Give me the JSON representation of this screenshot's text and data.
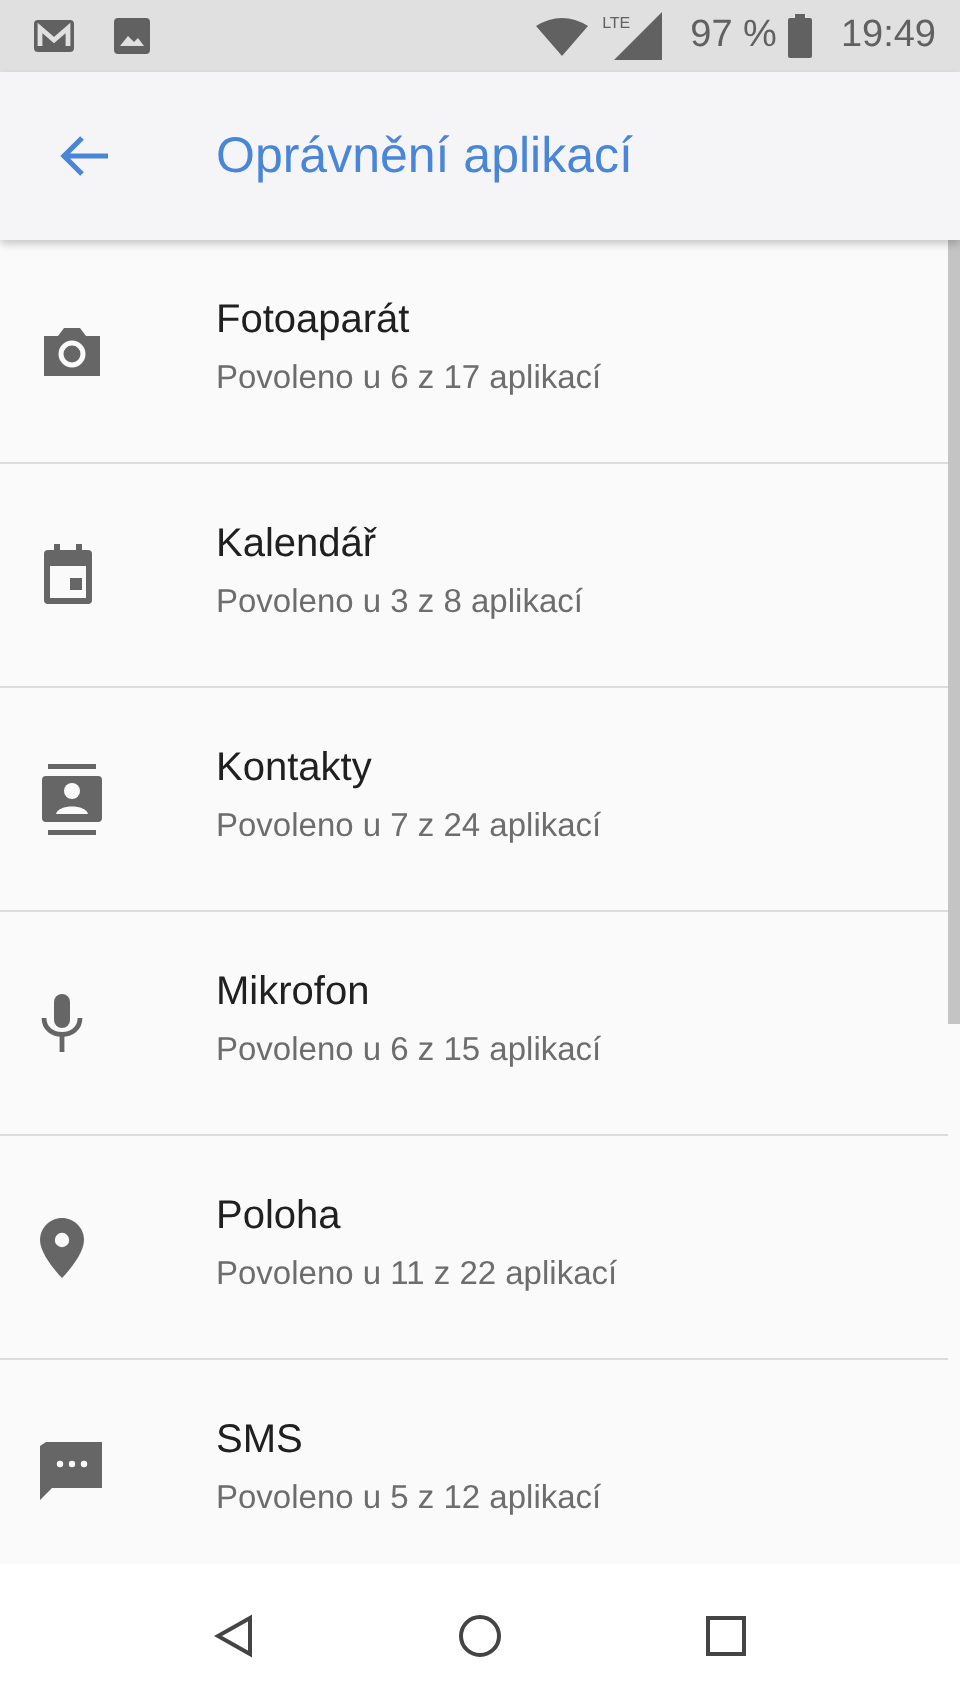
{
  "status_bar": {
    "network": "LTE",
    "battery": "97 %",
    "time": "19:49"
  },
  "app_bar": {
    "title": "Oprávnění aplikací"
  },
  "permissions": [
    {
      "name": "Fotoaparát",
      "summary": "Povoleno u 6 z 17 aplikací"
    },
    {
      "name": "Kalendář",
      "summary": "Povoleno u 3 z 8 aplikací"
    },
    {
      "name": "Kontakty",
      "summary": "Povoleno u 7 z 24 aplikací"
    },
    {
      "name": "Mikrofon",
      "summary": "Povoleno u 6 z 15 aplikací"
    },
    {
      "name": "Poloha",
      "summary": "Povoleno u 11 z 22 aplikací"
    },
    {
      "name": "SMS",
      "summary": "Povoleno u 5 z 12 aplikací"
    }
  ]
}
